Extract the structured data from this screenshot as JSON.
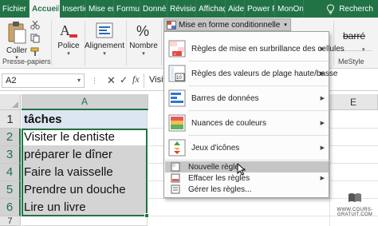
{
  "ribbon_tabs": [
    {
      "label": "Fichier"
    },
    {
      "label": "Accueil"
    },
    {
      "label": "Insertio"
    },
    {
      "label": "Mise en"
    },
    {
      "label": "Formul"
    },
    {
      "label": "Donnée"
    },
    {
      "label": "Révisior"
    },
    {
      "label": "Affichaç"
    },
    {
      "label": "Aide"
    },
    {
      "label": "Power F"
    },
    {
      "label": "MonOn"
    }
  ],
  "search_label": "Recherch",
  "ribbon": {
    "paste_label": "Coller",
    "clipboard_caption": "Presse-papiers",
    "font_label": "Police",
    "alignment_label": "Alignement",
    "number_label": "Nombre",
    "style_label": "barré",
    "mestyle_caption": "MeStyle"
  },
  "formula_bar": {
    "name_box": "A2",
    "content": "Visite"
  },
  "grid": {
    "columns": [
      "A",
      "E"
    ],
    "rows": [
      {
        "num": "1",
        "value": "tâches"
      },
      {
        "num": "2",
        "value": "Visiter le dentiste"
      },
      {
        "num": "3",
        "value": "préparer le dîner"
      },
      {
        "num": "4",
        "value": "Faire la vaisselle"
      },
      {
        "num": "5",
        "value": "Prendre un douche"
      },
      {
        "num": "6",
        "value": "Lire un livre"
      },
      {
        "num": "7",
        "value": ""
      }
    ]
  },
  "conditional_format": {
    "button_label": "Mise en forme conditionnelle",
    "items": [
      {
        "label": "Règles de mise en surbrillance des cellules",
        "icon": "highlight-rules-icon",
        "submenu": true
      },
      {
        "label": "Règles des valeurs de plage haute/basse",
        "icon": "top-bottom-rules-icon",
        "submenu": true
      },
      {
        "label": "Barres de données",
        "icon": "data-bars-icon",
        "submenu": true
      },
      {
        "label": "Nuances de couleurs",
        "icon": "color-scales-icon",
        "submenu": true
      },
      {
        "label": "Jeux d'icônes",
        "icon": "icon-sets-icon",
        "submenu": true
      }
    ],
    "actions": [
      {
        "label": "Nouvelle règle...",
        "highlighted": true
      },
      {
        "label": "Effacer les règles",
        "submenu": true
      },
      {
        "label": "Gérer les règles..."
      }
    ]
  },
  "watermark_text": "WWW.COURS-GRATUIT.COM",
  "colors": {
    "excel_green": "#217346",
    "selection_gray": "#d4d4d4",
    "header_fill": "#dce6f1",
    "menu_highlight": "#c5c5c5"
  }
}
